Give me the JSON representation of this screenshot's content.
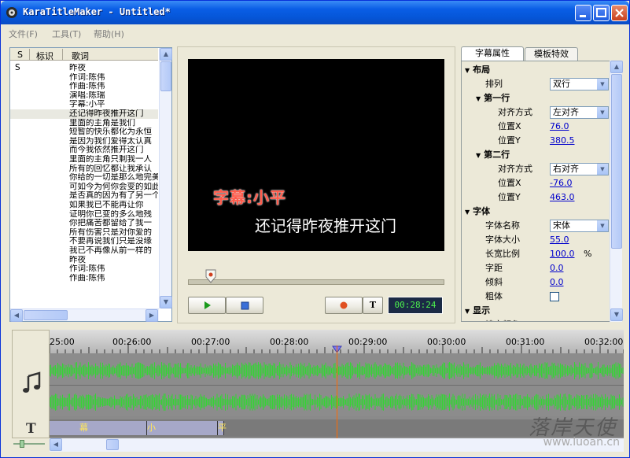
{
  "window": {
    "title": "KaraTitleMaker - Untitled*"
  },
  "menu": [
    "文件(F)",
    "工具(T)",
    "帮助(H)"
  ],
  "lyrics_list": {
    "columns": [
      "S",
      "标识",
      "歌词"
    ],
    "rows": [
      {
        "s": "S",
        "text": "昨夜"
      },
      {
        "s": "",
        "text": "作词:陈伟"
      },
      {
        "s": "",
        "text": "作曲:陈伟"
      },
      {
        "s": "",
        "text": "演唱:陈瑞"
      },
      {
        "s": "",
        "text": "字幕:小平"
      },
      {
        "s": "",
        "text": "还记得昨夜推开这门"
      },
      {
        "s": "",
        "text": "里面的主角是我们"
      },
      {
        "s": "",
        "text": "短暂的快乐都化为永恒"
      },
      {
        "s": "",
        "text": "是因为我们爱得太认真"
      },
      {
        "s": "",
        "text": "而今我依然推开这门"
      },
      {
        "s": "",
        "text": "里面的主角只剩我一人"
      },
      {
        "s": "",
        "text": "所有的回忆都让我承认"
      },
      {
        "s": "",
        "text": "你给的一切是那么地完美"
      },
      {
        "s": "",
        "text": "可如今为何你会变的如此"
      },
      {
        "s": "",
        "text": "是否真的因为有了另一个"
      },
      {
        "s": "",
        "text": "如果我已不能再让你"
      },
      {
        "s": "",
        "text": "证明你已变的多么地残"
      },
      {
        "s": "",
        "text": "你把痛苦都留给了我一"
      },
      {
        "s": "",
        "text": "所有伤害只是对你爱的"
      },
      {
        "s": "",
        "text": "不要再说我们只是没缘"
      },
      {
        "s": "",
        "text": "我已不再像从前一样的"
      },
      {
        "s": "",
        "text": "昨夜"
      },
      {
        "s": "",
        "text": "作词:陈伟"
      },
      {
        "s": "",
        "text": "作曲:陈伟"
      }
    ],
    "selected_index": 5
  },
  "preview": {
    "line1": "字幕:小平",
    "line2": "还记得昨夜推开这门",
    "time": "00:28:24",
    "text_button": "T"
  },
  "props": {
    "tabs": [
      "字幕属性",
      "模板特效"
    ],
    "rows": [
      {
        "type": "group",
        "label": "布局",
        "indent": 0
      },
      {
        "type": "select",
        "label": "排列",
        "value": "双行",
        "indent": 1
      },
      {
        "type": "group",
        "label": "第一行",
        "indent": 1
      },
      {
        "type": "select",
        "label": "对齐方式",
        "value": "左对齐",
        "indent": 2
      },
      {
        "type": "value",
        "label": "位置X",
        "value": "76.0",
        "indent": 2
      },
      {
        "type": "value",
        "label": "位置Y",
        "value": "380.5",
        "indent": 2
      },
      {
        "type": "group",
        "label": "第二行",
        "indent": 1
      },
      {
        "type": "select",
        "label": "对齐方式",
        "value": "右对齐",
        "indent": 2
      },
      {
        "type": "value",
        "label": "位置X",
        "value": "-76.0",
        "indent": 2
      },
      {
        "type": "value",
        "label": "位置Y",
        "value": "463.0",
        "indent": 2
      },
      {
        "type": "group",
        "label": "字体",
        "indent": 0
      },
      {
        "type": "select",
        "label": "字体名称",
        "value": "宋体",
        "indent": 1
      },
      {
        "type": "value",
        "label": "字体大小",
        "value": "55.0",
        "indent": 1
      },
      {
        "type": "value",
        "label": "长宽比例",
        "value": "100.0",
        "suffix": "%",
        "indent": 1
      },
      {
        "type": "value",
        "label": "字距",
        "value": "0.0",
        "indent": 1
      },
      {
        "type": "value",
        "label": "倾斜",
        "value": "0.0",
        "indent": 1
      },
      {
        "type": "check",
        "label": "粗体",
        "value": "",
        "indent": 1
      },
      {
        "type": "group",
        "label": "显示",
        "indent": 0
      },
      {
        "type": "value",
        "label": "填充颜色",
        "value": "",
        "indent": 1
      }
    ]
  },
  "timeline": {
    "ticks": [
      "25:00",
      "00:26:00",
      "00:27:00",
      "00:28:00",
      "00:29:00",
      "00:30:00",
      "00:31:00",
      "00:32:00"
    ],
    "clips": [
      "幕",
      "小",
      "平"
    ]
  },
  "watermark": {
    "text": "落岸天使",
    "url": "www.luoan.cn"
  },
  "colors": {
    "waveform": "#35D435",
    "cursor": "#FF6A00",
    "title_bar": "#0A5EE6",
    "time_text": "#4DF04D"
  }
}
